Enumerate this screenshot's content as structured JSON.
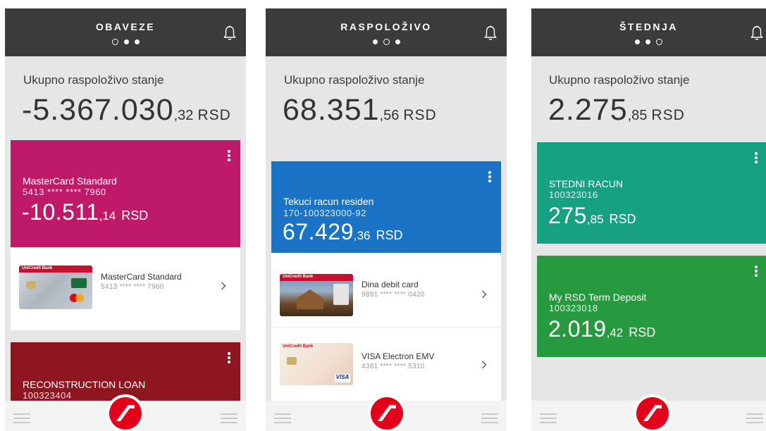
{
  "screens": [
    {
      "title": "OBAVEZE",
      "active_dot": 0,
      "balance_label": "Ukupno raspoloživo stanje",
      "balance_int": "-5.367.030",
      "balance_dec": ",32",
      "currency": "RSD",
      "cards": [
        {
          "name": "MasterCard Standard",
          "number": "5413 **** **** 7960",
          "amount_int": "-10.511",
          "amount_dec": ",14",
          "currency": "RSD",
          "color": "#bf1a6a"
        },
        {
          "name": "RECONSTRUCTION LOAN",
          "number": "100323404",
          "color": "#8f1520"
        }
      ],
      "subitems": [
        {
          "name": "MasterCard Standard",
          "number": "5413 **** **** 7960",
          "card_text": "UniCredit Bank"
        }
      ]
    },
    {
      "title": "RASPOLOŽIVO",
      "active_dot": 1,
      "balance_label": "Ukupno raspoloživo stanje",
      "balance_int": "68.351",
      "balance_dec": ",56",
      "currency": "RSD",
      "cards": [
        {
          "name": "Tekuci racun residen",
          "number": "170-100323000-92",
          "amount_int": "67.429",
          "amount_dec": ",36",
          "currency": "RSD",
          "color": "#1a73c4"
        }
      ],
      "subitems": [
        {
          "name": "Dina debit card",
          "number": "9891 **** **** 0420",
          "card_text": "UniCredit Bank"
        },
        {
          "name": "VISA Electron EMV",
          "number": "4381 **** **** 5310",
          "card_text": "UniCredit Bank",
          "card_text2": "VISA"
        }
      ]
    },
    {
      "title": "ŠTEDNJA",
      "active_dot": 2,
      "balance_label": "Ukupno raspoloživo stanje",
      "balance_int": "2.275",
      "balance_dec": ",85",
      "currency": "RSD",
      "cards": [
        {
          "name": "STEDNI RACUN",
          "number": "100323016",
          "amount_int": "275",
          "amount_dec": ",85",
          "currency": "RSD",
          "color": "#16a182"
        },
        {
          "name": "My RSD Term Deposit",
          "number": "100323018",
          "amount_int": "2.019",
          "amount_dec": ",42",
          "currency": "RSD",
          "color": "#27993f"
        }
      ],
      "subitems": []
    }
  ],
  "colors": {
    "topbar": "#3b3b3b",
    "background": "#e6e6e6",
    "brand_red": "#e2001a"
  },
  "icons": {
    "notification": "bell-icon",
    "menu": "hamburger-icon",
    "brand": "unicredit-logo-icon",
    "card_menu": "more-vertical-icon",
    "row_arrow": "chevron-right-icon"
  }
}
